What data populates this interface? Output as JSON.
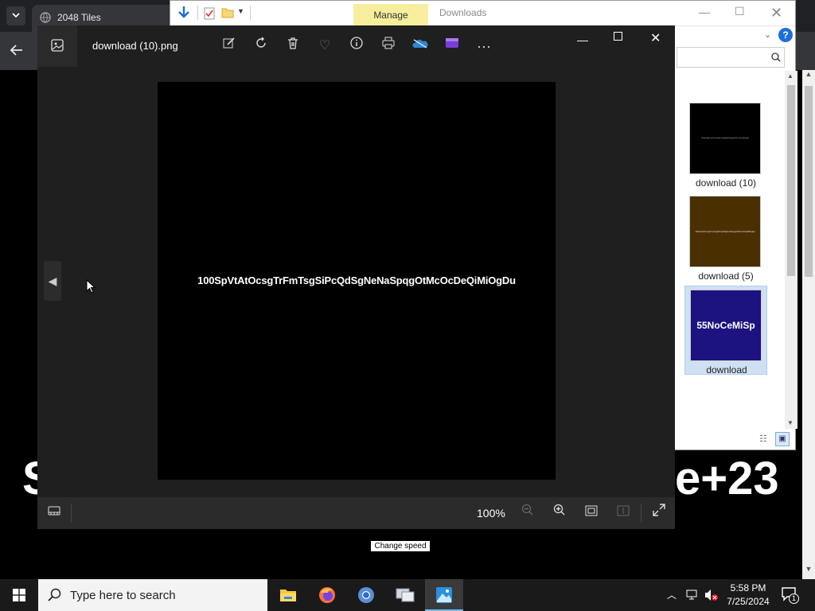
{
  "browser": {
    "tab_title": "2048 Tiles",
    "big_text_left": "S",
    "big_text_right": "e+23"
  },
  "explorer": {
    "ribbon_manage": "Manage",
    "window_title": "Downloads",
    "help_label": "?",
    "items": [
      {
        "caption": "download (10)",
        "thumb_text": "100SpVtAtOcsgTrFmTsgSiPcQdSgNeNaSpqgOtMcOcDeQiMiOgDu",
        "thumb_bg": "#000000"
      },
      {
        "caption": "download (5)",
        "thumb_text": "100SpVtAtOcsgTrFmTsgSiPcQdSgNeNaSpqgOtMcOcDeQiMiOgDu",
        "thumb_bg": "#4a3000"
      },
      {
        "caption": "download",
        "thumb_text": "55NoCeMiSp",
        "thumb_bg": "#1c1380"
      }
    ]
  },
  "viewer": {
    "file_name": "download (10).png",
    "image_text": "100SpVtAtOcsgTrFmTsgSiPcQdSgNeNaSpqgOtMcOcDeQiMiOgDu",
    "zoom": "100%",
    "more_label": "···",
    "toolbar_icons": [
      "edit-icon",
      "rotate-icon",
      "delete-icon",
      "favorite-icon",
      "info-icon",
      "print-icon",
      "onedrive-icon",
      "clipchamp-icon",
      "more-icon"
    ]
  },
  "tooltip": "Change speed",
  "taskbar": {
    "search_placeholder": "Type here to search",
    "time": "5:58 PM",
    "date": "7/25/2024",
    "notification_count": "1"
  },
  "colors": {
    "viewer_bg": "#1f1f1f",
    "manage_tab": "#f7ee9d",
    "taskbar": "#1a1a1a"
  }
}
